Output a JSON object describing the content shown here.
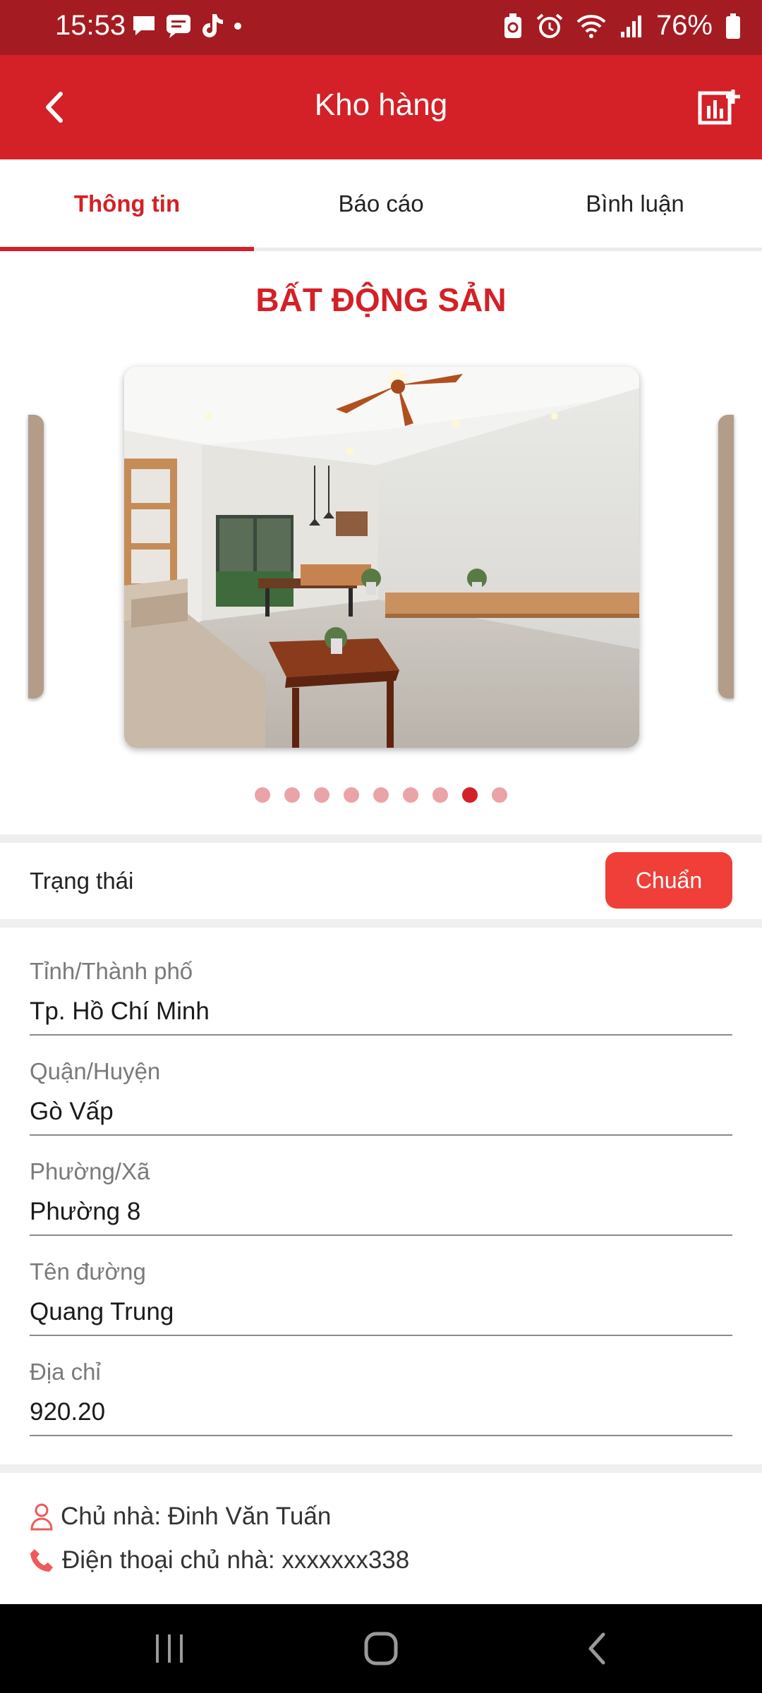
{
  "status_bar": {
    "time": "15:53",
    "battery": "76%",
    "left_icons": [
      "message-icon",
      "chat-icon",
      "tiktok-icon",
      "dot-icon"
    ],
    "right_icons": [
      "battery-saver-icon",
      "alarm-icon",
      "wifi-icon",
      "signal-icon",
      "battery-icon"
    ]
  },
  "header": {
    "title": "Kho hàng",
    "back_icon": "chevron-left-icon",
    "action_icon": "add-report-icon"
  },
  "tabs": [
    {
      "label": "Thông tin",
      "active": true
    },
    {
      "label": "Báo cáo",
      "active": false
    },
    {
      "label": "Bình luận",
      "active": false
    }
  ],
  "section_title": "BẤT ĐỘNG SẢN",
  "carousel": {
    "image_count": 9,
    "active_index": 7
  },
  "status": {
    "label": "Trạng thái",
    "value": "Chuẩn"
  },
  "fields": [
    {
      "label": "Tỉnh/Thành phố",
      "value": "Tp. Hồ Chí Minh"
    },
    {
      "label": "Quận/Huyện",
      "value": "Gò Vấp"
    },
    {
      "label": "Phường/Xã",
      "value": "Phường 8"
    },
    {
      "label": "Tên đường",
      "value": "Quang Trung"
    },
    {
      "label": "Địa chỉ",
      "value": "920.20"
    }
  ],
  "owner": {
    "name_line": "Chủ nhà: Đinh Văn Tuấn",
    "phone_line": "Điện thoại chủ nhà: xxxxxxx338"
  },
  "colors": {
    "status_bar": "#a51b22",
    "header": "#d42027",
    "accent": "#d42027",
    "badge": "#ef3f38"
  }
}
